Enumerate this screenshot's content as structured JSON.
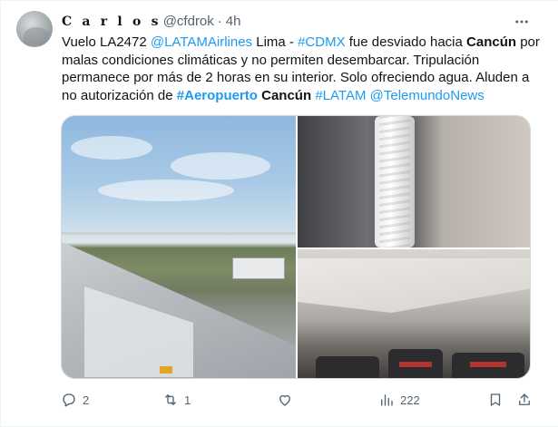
{
  "tweet": {
    "author_name": "C a r l o s",
    "handle": "@cfdrok",
    "separator": "·",
    "time": "4h",
    "text": {
      "t1": "Vuelo LA2472 ",
      "mention1": "@LATAMAirlines",
      "t2": " Lima - ",
      "hashtag1": "#CDMX",
      "t3": " fue desviado hacia ",
      "bold1": "Cancún",
      "t4": " por malas condiciones climáticas y no permiten desembarcar. Tripulación permanece por más de 2 horas en su interior. Solo ofreciendo agua. Aluden a no autorización de ",
      "hashtag2": "#Aeropuerto",
      "t5": " ",
      "bold2": "Cancún",
      "t6": " ",
      "hashtag3": "#LATAM",
      "t7": " ",
      "mention2": "@TelemundoNews"
    },
    "media": [
      {
        "icon": "airplane-wing-photo"
      },
      {
        "icon": "cabin-wall-photo"
      },
      {
        "icon": "aircraft-cabin-photo"
      }
    ],
    "actions": {
      "replies": "2",
      "retweets": "1",
      "likes": "",
      "views": "222"
    }
  },
  "colors": {
    "link": "#1d9bf0",
    "text": "#0f1419",
    "secondary": "#536471",
    "border": "#cfd9de"
  }
}
